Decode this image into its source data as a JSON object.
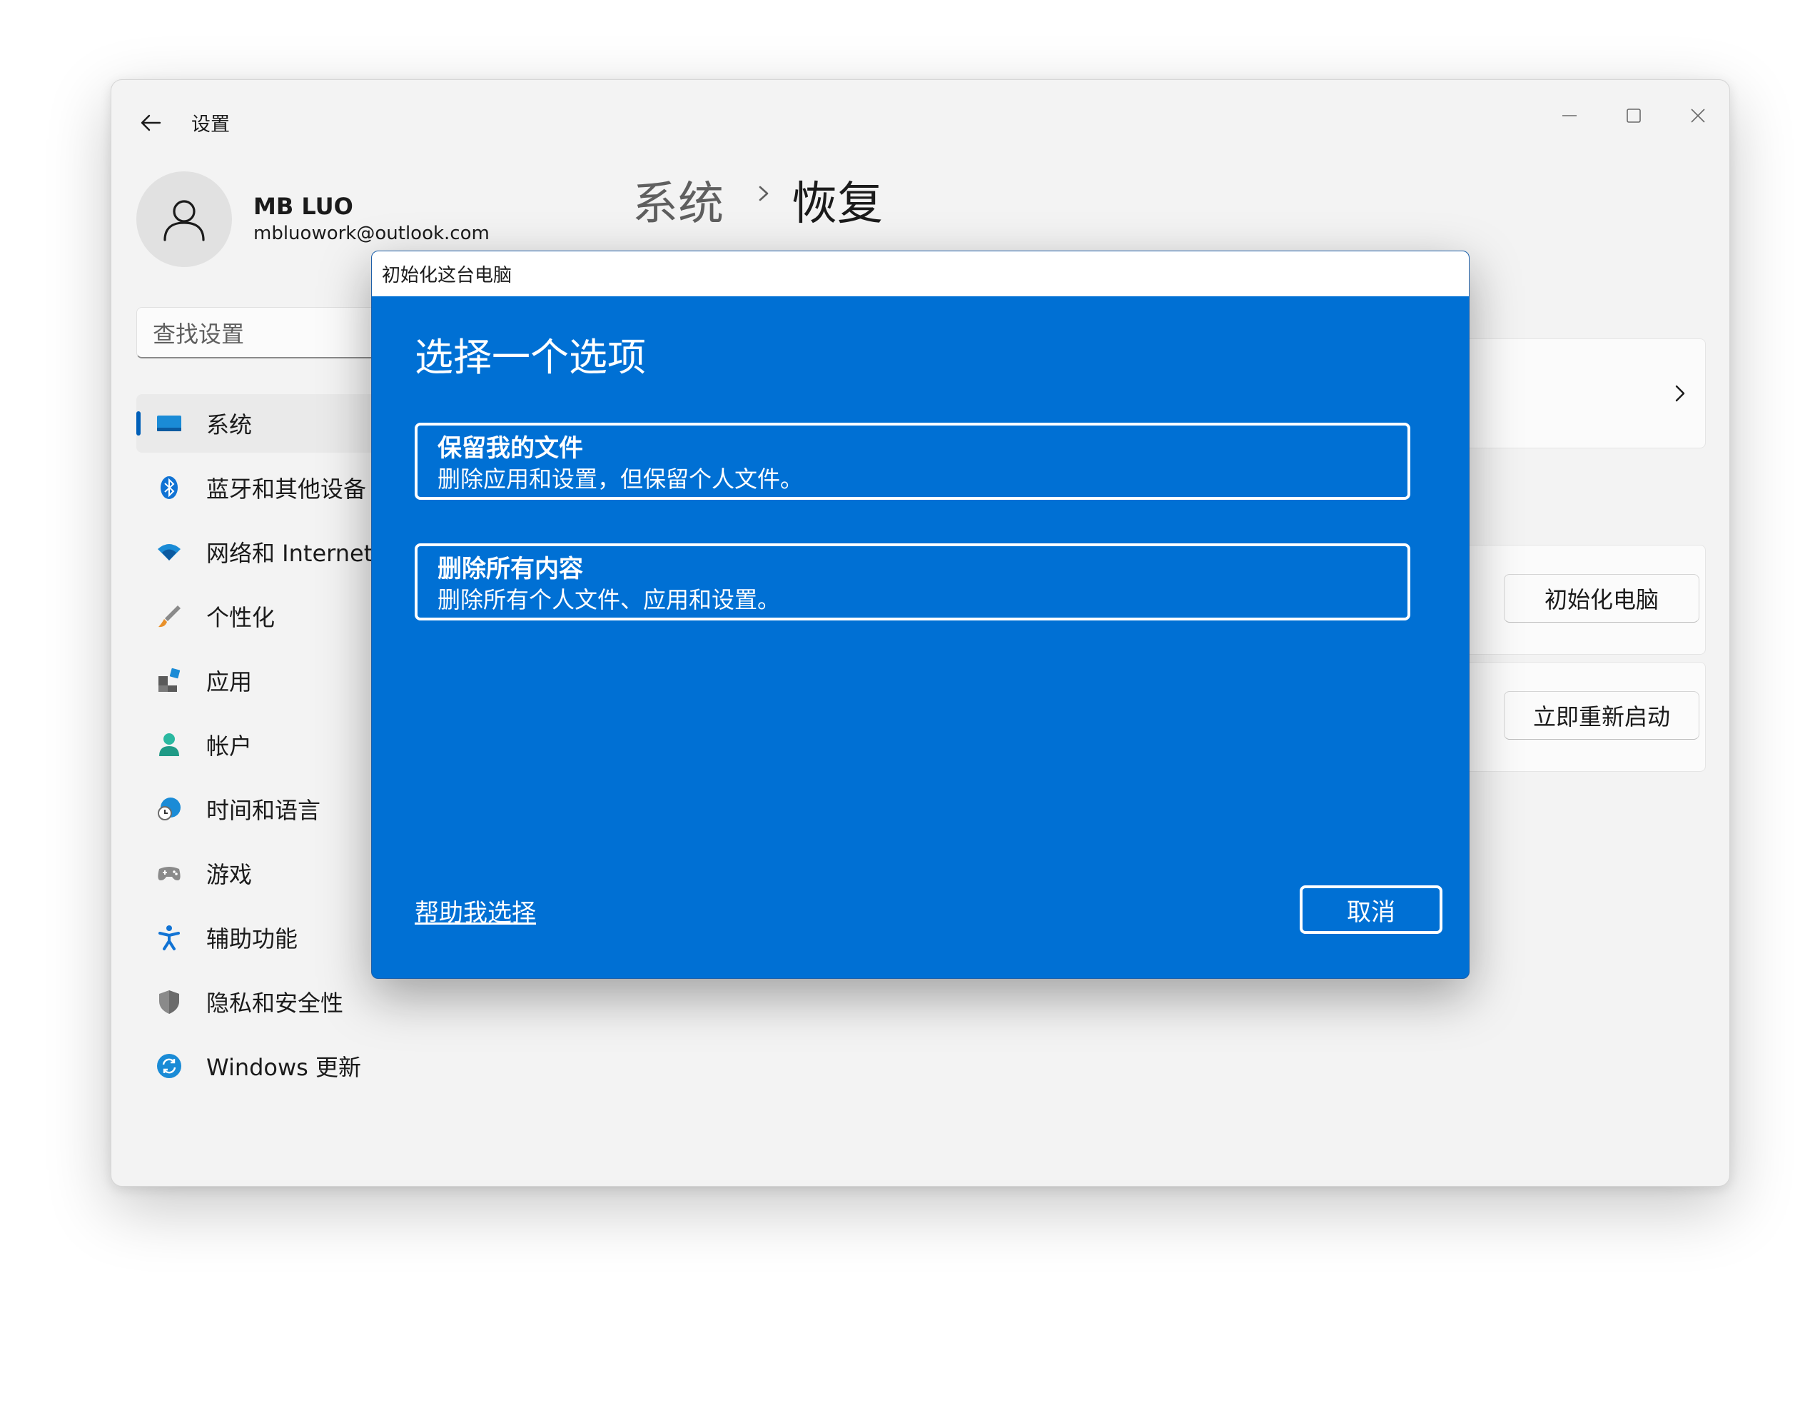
{
  "window": {
    "app_title": "设置",
    "controls": [
      "minimize",
      "maximize",
      "close"
    ]
  },
  "user": {
    "name": "MB LUO",
    "email": "mbluowork@outlook.com"
  },
  "search": {
    "placeholder": "查找设置"
  },
  "sidebar": {
    "items": [
      {
        "label": "系统",
        "icon": "system-display-icon",
        "active": true
      },
      {
        "label": "蓝牙和其他设备",
        "icon": "bluetooth-icon"
      },
      {
        "label": "网络和 Internet",
        "icon": "wifi-icon"
      },
      {
        "label": "个性化",
        "icon": "brush-icon"
      },
      {
        "label": "应用",
        "icon": "apps-icon"
      },
      {
        "label": "帐户",
        "icon": "account-icon"
      },
      {
        "label": "时间和语言",
        "icon": "globe-clock-icon"
      },
      {
        "label": "游戏",
        "icon": "gamepad-icon"
      },
      {
        "label": "辅助功能",
        "icon": "accessibility-icon"
      },
      {
        "label": "隐私和安全性",
        "icon": "shield-icon"
      },
      {
        "label": "Windows 更新",
        "icon": "update-icon"
      }
    ]
  },
  "breadcrumb": {
    "parent": "系统",
    "current": "恢复"
  },
  "background_buttons": {
    "reset_pc": "初始化电脑",
    "restart_now": "立即重新启动"
  },
  "dialog": {
    "window_title": "初始化这台电脑",
    "heading": "选择一个选项",
    "options": [
      {
        "title": "保留我的文件",
        "description": "删除应用和设置，但保留个人文件。"
      },
      {
        "title": "删除所有内容",
        "description": "删除所有个人文件、应用和设置。"
      }
    ],
    "help_link": "帮助我选择",
    "cancel_label": "取消"
  },
  "colors": {
    "dialog_blue": "#0070d4",
    "accent": "#005fb8",
    "window_bg": "#f3f3f3"
  }
}
